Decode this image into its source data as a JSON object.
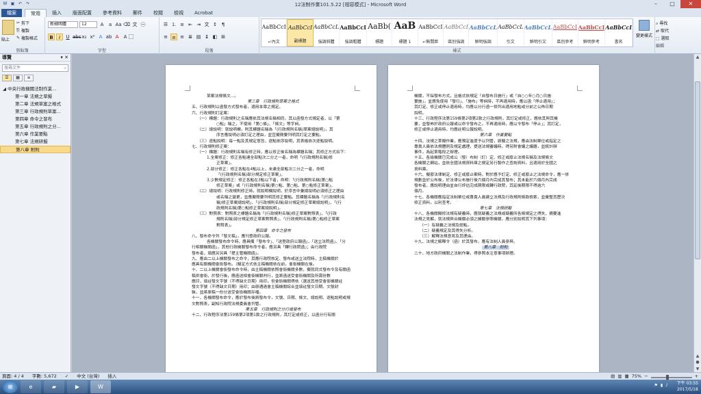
{
  "window": {
    "title": "12法制作業101.5.22 [相容模式] - Microsoft Word",
    "controls": [
      "minimize",
      "maximize",
      "close"
    ]
  },
  "qat": [
    "save-icon",
    "undo-icon",
    "redo-icon"
  ],
  "tabs": [
    "檔案",
    "常用",
    "插入",
    "版面配置",
    "參考資料",
    "郵件",
    "校閱",
    "檢視",
    "Acrobat"
  ],
  "ribbon": {
    "clipboard": {
      "paste": "貼上",
      "cut": "剪下",
      "copy": "複製",
      "format_painter": "複製格式",
      "label": "剪貼簿"
    },
    "font": {
      "name": "新細明體",
      "size": "12",
      "label": "字型"
    },
    "paragraph": {
      "label": "段落"
    },
    "styles": {
      "label": "樣式",
      "items": [
        {
          "preview": "AaBbCcI",
          "name": "↵內文"
        },
        {
          "preview": "AaBbCcI",
          "name": "副標題"
        },
        {
          "preview": "AaBbCcL",
          "name": "強調斜體"
        },
        {
          "preview": "AaBbCcI",
          "name": "強調粗體"
        },
        {
          "preview": "AaBb(",
          "name": "標題"
        },
        {
          "preview": "AaB",
          "name": "標題 1"
        },
        {
          "preview": "AaBbCcI",
          "name": "↵無間距"
        },
        {
          "preview": "AaBbCcI",
          "name": "區別強調"
        },
        {
          "preview": "AaBbCcL",
          "name": "鮮明強調"
        },
        {
          "preview": "AaBbCcL",
          "name": "引文"
        },
        {
          "preview": "AaBbCcL",
          "name": "鮮明引文"
        },
        {
          "preview": "AaBbCcI",
          "name": "區別參考"
        },
        {
          "preview": "AaBbCcI",
          "name": "鮮明參考"
        },
        {
          "preview": "AaBbCcI",
          "name": "書名"
        }
      ],
      "change": "變更樣式"
    },
    "editing": {
      "find": "尋找",
      "replace": "取代",
      "select": "選取",
      "label": "編輯"
    }
  },
  "nav": {
    "title": "導覽",
    "search_placeholder": "搜尋文件",
    "root": "中央行政機關法制作業...",
    "items": [
      "第一章 法規之草擬",
      "第二章 法規草案之格式",
      "第三章 行政規則草案...",
      "第四章 命令之發布",
      "第五章 行政規則之分...",
      "第六章 作業要點",
      "第七章 法規研擬",
      "第八章 附則"
    ],
    "selected": 7
  },
  "page1": [
    {
      "t": "某案法規條文...。",
      "c": "ind2"
    },
    {
      "t": "第三章　行政規則草案之格式",
      "c": "h"
    },
    {
      "t": "五、行政規則以函發方式發布者，適用本章之規定。",
      "c": ""
    },
    {
      "t": "六、行政規則訂定案：",
      "c": ""
    },
    {
      "t": "（一）標題：行政規則之名稱應依其法規名稱相同，其以函發方式規定者，以「第",
      "c": "ind1"
    },
    {
      "t": "○點」稱之，不使用「第○條」、「條文」等字詞。",
      "c": "ind3"
    },
    {
      "t": "（二）總說明：就說明欄，則其標題名稱為「(行政規則名稱)草案總說明」，其",
      "c": "ind1"
    },
    {
      "t": "序言應說明必須訂定之理由，並宜擬簡要列明其訂定之要點。",
      "c": "ind3"
    },
    {
      "t": "（三）逐點說明：每一點及其規定意旨，逐點依序說明，其表格依次逐點說明。",
      "c": "ind1"
    },
    {
      "t": "七、行政規則修正案：",
      "c": ""
    },
    {
      "t": "（一）標題：行政規則名稱有修正時，應以修正後名稱為標題名稱；其修正方式如下：",
      "c": "ind1"
    },
    {
      "t": "1.全案修正：修正各點達全部點次二分之一者，命明「(行政規則名稱)修",
      "c": "ind2"
    },
    {
      "t": "正草案」。",
      "c": "ind3"
    },
    {
      "t": "2.部分修正：修正各點在4點以上，未達全部點次二分之一者，命明",
      "c": "ind2"
    },
    {
      "t": "「(行政規則名稱)部分規定修正草案」。",
      "c": "ind3"
    },
    {
      "t": "3.少數規定修正：修正各點在3點以下者，命明：「(行政規則名稱)第○點",
      "c": "ind2"
    },
    {
      "t": "修正草案」或「(行政規則名稱)第○點、第○點、第○點修正草案」。",
      "c": "ind3"
    },
    {
      "t": "（二）總說明：行政規則修正時，就說明欄說明，於序言中彙總說明必須修正之理由",
      "c": "ind1"
    },
    {
      "t": "或名稱之變更，並應擬簡要列明其修正要點。其標題名稱為「(行政規則名",
      "c": "ind3"
    },
    {
      "t": "稱)修正草案總說明」、「(行政規則名稱)部分規定修正草案總說明」、「(行",
      "c": "ind3"
    },
    {
      "t": "政規則名稱)第○點修正草案總說明」。",
      "c": "ind3"
    },
    {
      "t": "（三）對照表：對照表之標題名稱為「(行政規則名稱)修正草案對照表」、「(行政",
      "c": "ind1"
    },
    {
      "t": "規則名稱)部分規定修正草案對照表」、「(行政規則名稱)第○點修正草案",
      "c": "ind3"
    },
    {
      "t": "對照表」。",
      "c": "ind3"
    },
    {
      "t": "第四章　命令之發布",
      "c": "h"
    },
    {
      "t": "八、發布命令列「發文稿」，應刊登政府公報。",
      "c": ""
    },
    {
      "t": "各機關發布命令時，應具備「發布令」、「送登政府公報函」、「送立法院函」、「分",
      "c": "ind2"
    },
    {
      "t": "行相關機關函」，其他行政機關發布命令者，應另具「轉行政院函」；由行政院",
      "c": ""
    },
    {
      "t": "發布者，填應另另具「提主管機關函」。",
      "c": ""
    },
    {
      "t": "九、應由二以上機關發布之命令，其應行政院核定、發布或送立法院時，主稿機關於",
      "c": ""
    },
    {
      "t": "應具有關機關會銜發布。（擬定方式依主稿機關依在前，會銜機關在後。",
      "c": ""
    },
    {
      "t": "十、二以上機關會銜發布命令時，由主稿機關依照會銜機關多數，擬就同式發布令及有關函",
      "c": ""
    },
    {
      "t": "稿併會銜，於發行後，應函送相會銜機關判行，並將函送受會銜機關及所需份數",
      "c": ""
    },
    {
      "t": "應印，填註發文字號（不得缺文日期）用印，但會銜機關得依（選送其他受會銜機關註",
      "c": ""
    },
    {
      "t": "發文字號（不得缺文日期）用印；由原通過會主稿機關綜合並填註發文日期、文號封",
      "c": ""
    },
    {
      "t": "裝，並將原稿一份分送受會銜機關存檔。",
      "c": ""
    },
    {
      "t": "十一、各機關發布命令，應於發布後將發布令，文號、日期、條文、總說明、逐點說明或規",
      "c": ""
    },
    {
      "t": "文對照表，副知行政院法規委員會列管。",
      "c": ""
    },
    {
      "t": "第五章　行政規則之分行或發布",
      "c": "h"
    },
    {
      "t": "十二、行政程序法第159條第2項第1款之行政規則，其訂定或修正，以函分行有關",
      "c": ""
    }
  ],
  "page2": [
    {
      "t": "機關，不採發布方式，且格式依規定「自發布日施行」或「自○○年○月○日施",
      "c": ""
    },
    {
      "t": "實施」，並應免使用「發行」、「施布」等詞時，不再適用時，應以函「停止適用」；",
      "c": ""
    },
    {
      "t": "其訂定、修正或停止適用時，均應以分行函一併列出適用地點或分前之公佈日期",
      "c": ""
    },
    {
      "t": "說明。",
      "c": ""
    },
    {
      "t": "十三、行政程序法第159條第2項第2款之行政規則，其訂定或修正，應依其與其機",
      "c": ""
    },
    {
      "t": "要，並發佈於政府公報或以命令發布之，不再適用時，應以令發布「停止」；其訂定，",
      "c": ""
    },
    {
      "t": "修正或停止適用時，均應註明公報說明。",
      "c": ""
    },
    {
      "t": "第六章　作業要點",
      "c": "h"
    },
    {
      "t": "十四、法規之草擬作業，應預定進度予以列管，原擬之法規，應由法制單位或指定之",
      "c": ""
    },
    {
      "t": "專責人員依法規體例及規定處理，提送法規審議時，得另附會議之議題，並統計辦",
      "c": ""
    },
    {
      "t": "事件，為起草階段之辦理。",
      "c": ""
    },
    {
      "t": "十五、各級機關已完成公（發）布制（訂）定、修正或廢止法規名稱及法規條文",
      "c": ""
    },
    {
      "t": "各機關之網站，並依全國法規資料庫之規定另行製作之查詢資料，且適用於全國之",
      "c": ""
    },
    {
      "t": "資料庫。",
      "c": ""
    },
    {
      "t": "十六、擬廢法律制定、修正或廢止案時，對於應予訂定、修正或廢止之法規命令，應一併",
      "c": ""
    },
    {
      "t": "規劃並於公布後，於法律公布施行後六個月內完成其發布；其未能於六個月內完成",
      "c": ""
    },
    {
      "t": "發布者，應說明理由並自行評估完成期限或轉行政院，其延後期限不得逾六",
      "c": ""
    },
    {
      "t": "個月。",
      "c": ""
    },
    {
      "t": "十七、各機關應指定法制單位或專責人員建立法規及行政規則條款檢索，並彙整其歷次",
      "c": ""
    },
    {
      "t": "修正資料，以利查考。",
      "c": ""
    },
    {
      "t": "第七章　法規研擬",
      "c": "h"
    },
    {
      "t": "十八、各機關擬修法規有疑義時，應就疑義之法規或疑義所各條規定之得失，摘要進",
      "c": ""
    },
    {
      "t": "法規之見解，就法規與合機關必須之機關參照機關，應分別說明其下列事項：",
      "c": ""
    },
    {
      "t": "（一）有疑義之法規及經點。",
      "c": "ind1"
    },
    {
      "t": "（二）疑義規定及其得失分析。",
      "c": "ind1"
    },
    {
      "t": "（三）解釋法規意見及其理由。",
      "c": "ind1"
    },
    {
      "t": "十九、法規之解釋令（函）於其發布，應有法制人員參與。",
      "c": ""
    },
    {
      "t": "第八章　附則",
      "c": "h hlx"
    },
    {
      "t": "二十、地方政府機關之法制作業，得參照本注意事項辦理。",
      "c": ""
    }
  ],
  "status": {
    "page": "頁面: 4 / 4",
    "words": "字數: 5,672",
    "lang": "中文 (台灣)",
    "mode": "插入",
    "zoom": "75%"
  },
  "taskbar": {
    "time": "下午 03:55",
    "date": "2017/5/18"
  }
}
